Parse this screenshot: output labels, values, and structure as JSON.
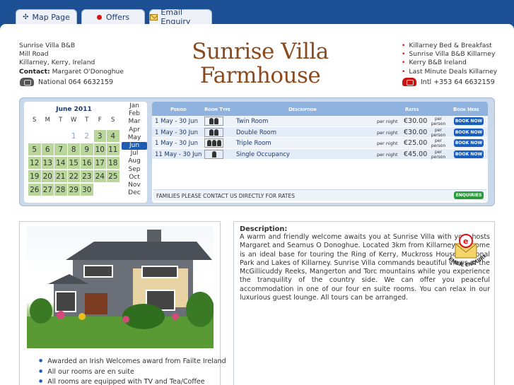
{
  "tabs": [
    {
      "label": "Map Page",
      "icon": "compass-icon"
    },
    {
      "label": "Offers",
      "icon": "red-dot-icon"
    },
    {
      "label": "Email Enquiry",
      "icon": "envelope-icon"
    }
  ],
  "address": {
    "name": "Sunrise Villa B&B",
    "street": "Mill Road",
    "town": "Killarney, Kerry, Ireland",
    "contact_label": "Contact:",
    "contact_name": "Margaret O'Donoghue",
    "phone_national": "National 064 6632159"
  },
  "title": {
    "line1": "Sunrise Villa",
    "line2": "Farmhouse"
  },
  "links": [
    "Killarney Bed & Breakfast",
    "Sunrise Villa B&B Killarney",
    "Kerry B&B Ireland",
    "Last Minute Deals Killarney"
  ],
  "phone_intl": "Intl +353 64 6632159",
  "calendar": {
    "header": "June 2011",
    "weekdays": [
      "S",
      "M",
      "T",
      "W",
      "T",
      "F",
      "S"
    ],
    "past": [
      "1",
      "2"
    ],
    "available": [
      "3",
      "4",
      "5",
      "6",
      "7",
      "8",
      "9",
      "10",
      "11",
      "12",
      "13",
      "14",
      "15",
      "16",
      "17",
      "18",
      "19",
      "20",
      "21",
      "22",
      "23",
      "24",
      "25",
      "26",
      "27",
      "28",
      "29",
      "30"
    ],
    "months": [
      "Jan",
      "Feb",
      "Mar",
      "Apr",
      "May",
      "Jun",
      "Jul",
      "Aug",
      "Sep",
      "Oct",
      "Nov",
      "Dec"
    ],
    "selected_month": "Jun",
    "available_color": "#b9d79b"
  },
  "rates": {
    "headers": {
      "period": "Period",
      "room_type": "Room Type",
      "description": "Description",
      "rates": "Rates",
      "book": "Book Here"
    },
    "rows": [
      {
        "period": "1 May - 30 Jun",
        "occupants": 2,
        "description": "Twin Room",
        "per_night": "per night",
        "price": "€30.00",
        "per_person": "per person",
        "book": "BOOK NOW"
      },
      {
        "period": "1 May - 30 Jun",
        "occupants": 2,
        "description": "Double Room",
        "per_night": "per night",
        "price": "€30.00",
        "per_person": "per person",
        "book": "BOOK NOW"
      },
      {
        "period": "1 May - 30 Jun",
        "occupants": 3,
        "description": "Triple Room",
        "per_night": "per night",
        "price": "€25.00",
        "per_person": "per person",
        "book": "BOOK NOW"
      },
      {
        "period": "11 May - 30 Jun",
        "occupants": 1,
        "description": "Single Occupancy",
        "per_night": "per night",
        "price": "€45.00",
        "per_person": "per person",
        "book": "BOOK NOW"
      }
    ],
    "families_note": "FAMILIES PLEASE CONTACT US DIRECTLY FOR RATES",
    "enquiries": "ENQUIRIES"
  },
  "photo_bullets": [
    "Awarded an Irish Welcomes award from Failte Ireland",
    "All our rooms are en suite",
    "All rooms are equipped with TV and Tea/Coffee"
  ],
  "description": {
    "label": "Description:",
    "text": "A warm and friendly welcome awaits you at Sunrise Villa with your hosts Margaret and Seamus O Donoghue. Located 3km from Killarney our home is an ideal base for touring the Ring of Kerry, Muckross House, National Park and Lakes of Killarney. Sunrise Villa commands beautiful views of the McGillicuddy Reeks, Mangerton and Torc mountains while you experience the tranquility of the country side. We can offer you peaceful accommodation in one of our four en suite rooms. You can relax in our luxurious guest lounge. All tours can be arranged.",
    "badge": "EMAIL ENQUIRIES"
  },
  "colors": {
    "background": "#1d4f95",
    "title": "#8a4a1e",
    "accent": "#1d5cb4",
    "book_button": "#1a5ec0",
    "enquiries_button": "#2a9a3a"
  }
}
